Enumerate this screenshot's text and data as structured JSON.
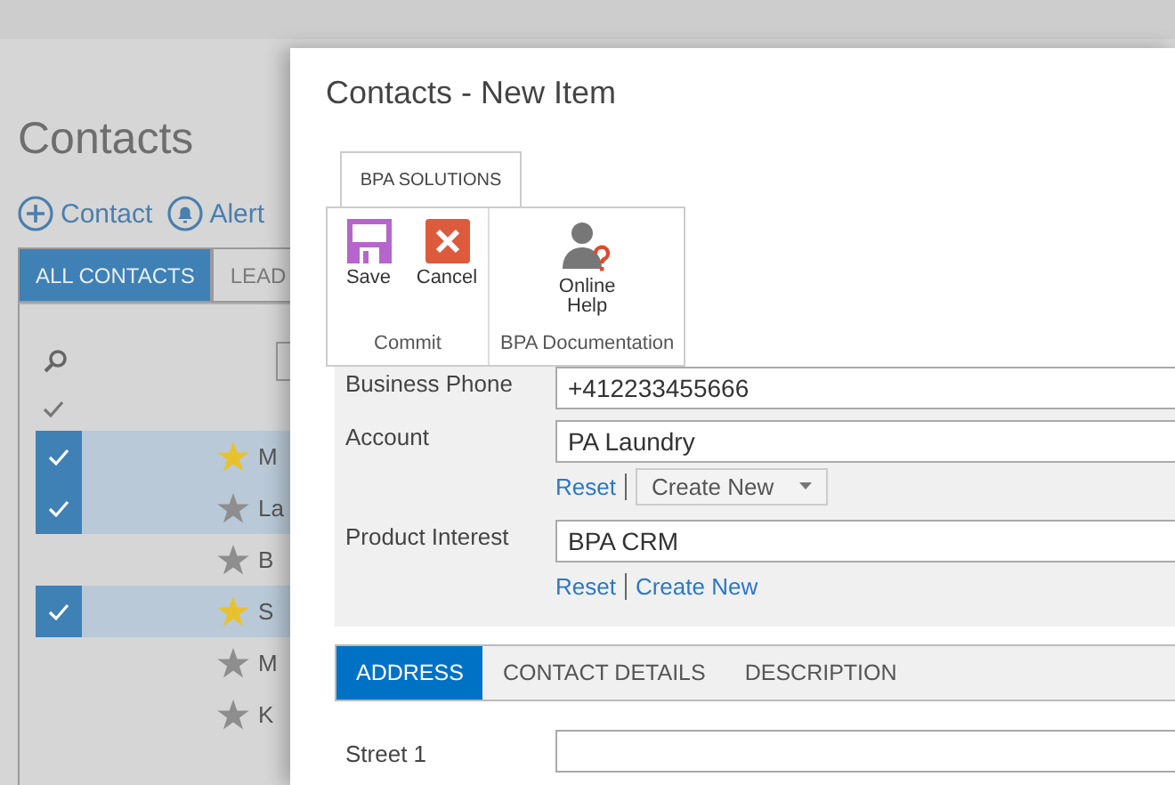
{
  "background": {
    "title": "Contacts",
    "toolbar": [
      {
        "label": "Contact",
        "kind": "add"
      },
      {
        "label": "Alert",
        "kind": "alert"
      }
    ],
    "tabs": [
      {
        "label": "ALL CONTACTS",
        "selected": true
      },
      {
        "label": "LEAD",
        "selected": false
      }
    ],
    "rows": [
      {
        "checked": true,
        "starred": true,
        "name": "M"
      },
      {
        "checked": true,
        "starred": false,
        "name": "La"
      },
      {
        "checked": false,
        "starred": false,
        "name": "B"
      },
      {
        "checked": true,
        "starred": true,
        "name": "S"
      },
      {
        "checked": false,
        "starred": false,
        "name": "M"
      },
      {
        "checked": false,
        "starred": false,
        "name": "K"
      }
    ]
  },
  "dialog": {
    "title": "Contacts - New Item",
    "ribbon": {
      "tab": "BPA SOLUTIONS",
      "groups": [
        {
          "label": "Commit",
          "buttons": [
            {
              "label": "Save",
              "kind": "save"
            },
            {
              "label": "Cancel",
              "kind": "cancel"
            }
          ]
        },
        {
          "label": "BPA Documentation",
          "buttons": [
            {
              "label": "Online Help",
              "kind": "help"
            }
          ]
        }
      ]
    },
    "fields": [
      {
        "label": "Business Phone",
        "value": "+412233455666"
      },
      {
        "label": "Account",
        "value": "PA Laundry",
        "links": [
          {
            "kind": "link",
            "label": "Reset"
          },
          {
            "kind": "dropdown",
            "label": "Create New"
          }
        ]
      },
      {
        "label": "Product Interest",
        "value": "BPA CRM",
        "links": [
          {
            "kind": "link",
            "label": "Reset"
          },
          {
            "kind": "link",
            "label": "Create New"
          }
        ]
      }
    ],
    "tabs": [
      {
        "label": "ADDRESS",
        "selected": true
      },
      {
        "label": "CONTACT DETAILS",
        "selected": false
      },
      {
        "label": "DESCRIPTION",
        "selected": false
      }
    ],
    "address_fields": [
      {
        "label": "Street 1"
      }
    ]
  }
}
